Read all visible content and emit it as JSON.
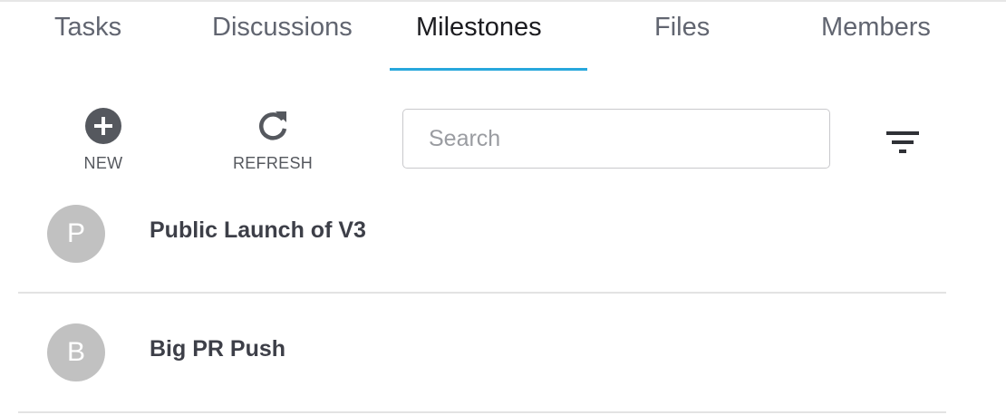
{
  "tabs": [
    {
      "label": "Tasks",
      "active": false
    },
    {
      "label": "Discussions",
      "active": false
    },
    {
      "label": "Milestones",
      "active": true
    },
    {
      "label": "Files",
      "active": false
    },
    {
      "label": "Members",
      "active": false
    }
  ],
  "toolbar": {
    "new_label": "NEW",
    "new_icon": "plus-circle-icon",
    "refresh_label": "REFRESH",
    "refresh_icon": "refresh-icon",
    "filter_icon": "filter-icon"
  },
  "search": {
    "placeholder": "Search",
    "value": ""
  },
  "milestones": [
    {
      "initial": "P",
      "title": "Public Launch of V3"
    },
    {
      "initial": "B",
      "title": "Big PR Push"
    }
  ],
  "colors": {
    "accent": "#27a7dc",
    "avatar_bg": "#c1c1c1",
    "icon_dark": "#55585e"
  }
}
